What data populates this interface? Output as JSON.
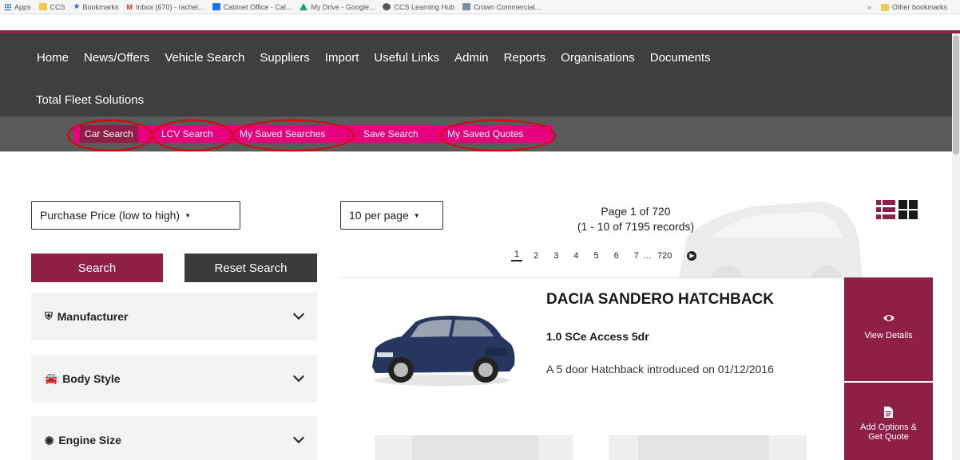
{
  "bookmarks": {
    "items": [
      {
        "label": "Apps",
        "icon": "apps-grid-icon"
      },
      {
        "label": "CCS",
        "icon": "folder-icon"
      },
      {
        "label": "Bookmarks",
        "icon": "star-icon"
      },
      {
        "label": "Inbox (670) - rachel...",
        "icon": "gmail-icon"
      },
      {
        "label": "Cabinet Office - Cal...",
        "icon": "calendar-icon"
      },
      {
        "label": "My Drive - Google...",
        "icon": "drive-icon"
      },
      {
        "label": "CCS Learning Hub",
        "icon": "hub-icon"
      },
      {
        "label": "Crown Commercial...",
        "icon": "crown-icon"
      }
    ],
    "more": "»",
    "other": "Other bookmarks"
  },
  "nav": {
    "items": [
      "Home",
      "News/Offers",
      "Vehicle Search",
      "Suppliers",
      "Import",
      "Useful Links",
      "Admin",
      "Reports",
      "Organisations",
      "Documents"
    ],
    "second_row": "Total Fleet Solutions"
  },
  "subnav": {
    "items": [
      "Car Search",
      "LCV Search",
      "My Saved Searches",
      "Save Search",
      "My Saved Quotes"
    ]
  },
  "sort": {
    "selected": "Purchase Price (low to high)"
  },
  "per_page": {
    "selected": "10 per page"
  },
  "pagination": {
    "page_label": "Page 1 of 720",
    "records_label": "(1 - 10 of 7195 records)",
    "pages": [
      "1",
      "2",
      "3",
      "4",
      "5",
      "6",
      "7"
    ],
    "ellipsis": "...",
    "last": "720"
  },
  "buttons": {
    "search": "Search",
    "reset": "Reset Search"
  },
  "filters": [
    {
      "label": "Manufacturer",
      "icon": "shield-icon"
    },
    {
      "label": "Body Style",
      "icon": "car-icon"
    },
    {
      "label": "Engine Size",
      "icon": "gauge-icon"
    }
  ],
  "vehicle": {
    "title": "DACIA SANDERO HATCHBACK",
    "trim": "1.0 SCe Access 5dr",
    "description": "A 5 door Hatchback introduced on 01/12/2016"
  },
  "actions": {
    "view_details": "View Details",
    "add_options": "Add Options & Get Quote"
  },
  "colors": {
    "brand": "#8e1f47",
    "subnav": "#e6007e",
    "nav": "#3f3f3f"
  }
}
